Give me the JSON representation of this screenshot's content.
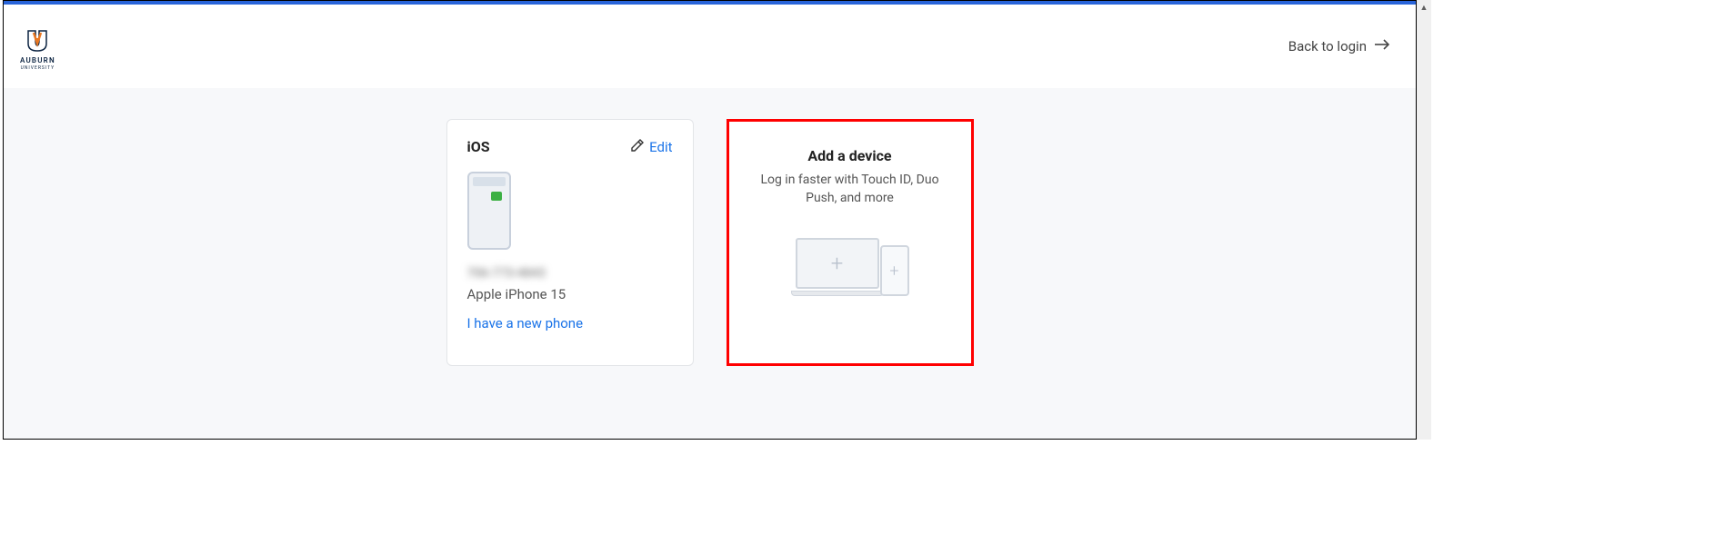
{
  "header": {
    "logo_text": "AUBURN",
    "logo_subtext": "UNIVERSITY",
    "back_link": "Back to login"
  },
  "device_card": {
    "title": "iOS",
    "edit_label": "Edit",
    "phone_number": "706-773-4843",
    "model": "Apple iPhone 15",
    "new_phone_link": "I have a new phone"
  },
  "add_card": {
    "title": "Add a device",
    "subtitle": "Log in faster with Touch ID, Duo Push, and more"
  }
}
